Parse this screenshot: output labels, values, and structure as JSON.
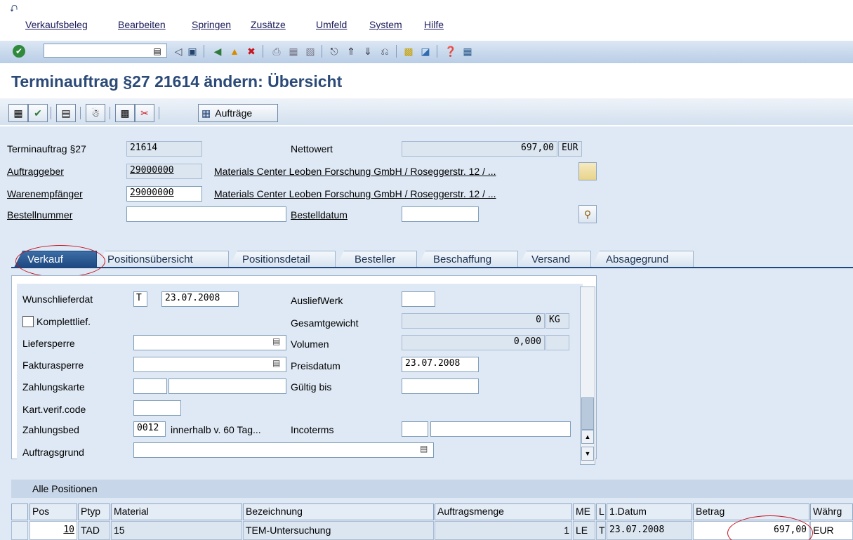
{
  "menu": {
    "items": [
      "Verkaufsbeleg",
      "Bearbeiten",
      "Springen",
      "Zusätze",
      "Umfeld",
      "System",
      "Hilfe"
    ]
  },
  "toolbar": {
    "command_value": ""
  },
  "title": "Terminauftrag §27 21614 ändern: Übersicht",
  "apptoolbar": {
    "orders_label": "Aufträge"
  },
  "header": {
    "order_label": "Terminauftrag §27",
    "order_value": "21614",
    "net_label": "Nettowert",
    "net_value": "697,00",
    "net_currency": "EUR",
    "soldto_label": "Auftraggeber",
    "soldto_value": "29000000",
    "soldto_text": "Materials Center Leoben Forschung GmbH / Roseggerstr. 12 / ...",
    "shipto_label": "Warenempfänger",
    "shipto_value": "29000000",
    "shipto_text": "Materials Center Leoben Forschung GmbH / Roseggerstr. 12 / ...",
    "po_label": "Bestellnummer",
    "po_value": "",
    "podate_label": "Bestelldatum",
    "podate_value": ""
  },
  "tabs": [
    "Verkauf",
    "Positionsübersicht",
    "Positionsdetail",
    "Besteller",
    "Beschaffung",
    "Versand",
    "Absagegrund"
  ],
  "sales": {
    "reqdate_label": "Wunschlieferdat",
    "reqdate_type": "T",
    "reqdate_value": "23.07.2008",
    "complete_label": "Komplettlief.",
    "delblock_label": "Liefersperre",
    "delblock_value": "",
    "billblock_label": "Fakturasperre",
    "billblock_value": "",
    "card_label": "Zahlungskarte",
    "cvc_label": "Kart.verif.code",
    "terms_label": "Zahlungsbed",
    "terms_value": "0012",
    "terms_text": "innerhalb v. 60 Tag...",
    "reason_label": "Auftragsgrund",
    "reason_value": "",
    "plant_label": "AusliefWerk",
    "plant_value": "",
    "weight_label": "Gesamtgewicht",
    "weight_value": "0",
    "weight_unit": "KG",
    "volume_label": "Volumen",
    "volume_value": "0,000",
    "volume_unit": "",
    "pricedate_label": "Preisdatum",
    "pricedate_value": "23.07.2008",
    "validto_label": "Gültig bis",
    "validto_value": "",
    "incoterms_label": "Incoterms",
    "incoterms_value1": "",
    "incoterms_value2": ""
  },
  "items": {
    "title": "Alle Positionen",
    "columns": [
      "Pos",
      "Ptyp",
      "Material",
      "Bezeichnung",
      "Auftragsmenge",
      "ME",
      "L.",
      "1.Datum",
      "Betrag",
      "Währg"
    ],
    "rows": [
      [
        "10",
        "TAD",
        "15",
        "TEM-Untersuchung",
        "1",
        "LE",
        "T",
        "23.07.2008",
        "697,00",
        "EUR"
      ]
    ]
  },
  "colors": {
    "title": "#2b4a78",
    "active_tab": "#1d4780",
    "annotation_circle": "#c8141e"
  }
}
